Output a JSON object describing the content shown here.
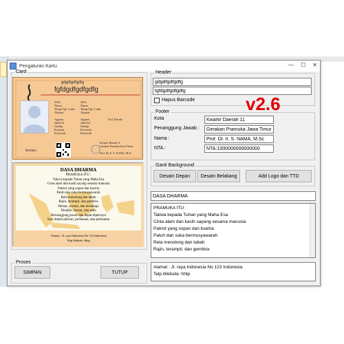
{
  "window": {
    "title": "Pengaturan Kartu",
    "minimize": "—",
    "maximize": "☐",
    "close": "✕"
  },
  "card_group": {
    "label": "Card"
  },
  "card_front": {
    "org_name": "gdgdfgdfgdfg",
    "org_name_big": "fgfdgdfgdfgdfg",
    "fields_left": [
      "NTA",
      "Nama",
      "Temp/Tgl. Lahir",
      "Alamat",
      "",
      "Agama",
      "Jab/Gol",
      "Gudep",
      "Kwaran",
      "Kwarcab"
    ],
    "fields_right": [
      "NTA",
      "Nama",
      "Temp/Tgl. Lahir",
      "Alamat",
      "",
      "Agama",
      "Jab/Gol",
      "Gudep",
      "Kwarran",
      "Kwarcab"
    ],
    "gol_darah": "Gol. Darah :",
    "berlaku": "Berlaku",
    "kwartir_sig": "Kwartir Daerah 11",
    "sig_org": "Gerakan Pramuka Jawa Timur",
    "sig_name": "Prof. Dr. Ir. S. NAMA, M.Sc"
  },
  "card_back": {
    "title": "DASA DHARMA",
    "subtitle": "PRAMUKA ITU :",
    "lines": [
      "Takwa kepada Tuhan yang Maha Esa",
      "Cinta alam dan kasih sayang sesama manusia",
      "Patriot yang sopan dan ksatria",
      "Patuh dan suka bermusyawarah",
      "Rela menolong dan tabah",
      "Rajin, terampil, dan gembira",
      "Hemat, cermat, dan bersahaja",
      "Disiplin, berani, dan setia",
      "Bertanggung jawab dan dapat dipercaya",
      "Suci dalam pikiran, perkataan, dan perbuatan"
    ],
    "alamat": "Alamat : Jl. raya Indonesia No 123 Indonesia",
    "telp": "Telp.Website :hhtp"
  },
  "header_group": {
    "label": "Header",
    "line1": "gdgdfgdfgdfg",
    "line2": "fgfdgdfgdfgdfg",
    "hapus_barcode": "Hapus Barcode",
    "hapus_checked": false
  },
  "version": "v2.6",
  "footer_group": {
    "label": "Footer",
    "kota_label": "Kota",
    "kota_value": "Kwartir Daerah 11",
    "pj_label": "Penanggung Jawab :",
    "pj_value": "Gerakan Pramuka Jawa Timur",
    "nama_label": "Nama :",
    "nama_value": "Prof. Dr. Ir. S. NAMA, M.Sc",
    "nta_label": "NTA :",
    "nta_value": "NTA:1000000000000000"
  },
  "bg_group": {
    "label": "Ganti Background",
    "btn_depan": "Desain Depan",
    "btn_belakang": "Desain Belakang",
    "btn_logo": "Add Logo dan TTD"
  },
  "dasa_title_field": "DASA DHARMA",
  "dasa_text": [
    "PRAMUKA ITU :",
    "Takwa kepada Tuhan yang Maha Esa",
    "Cinta alam dan kasih sayang sesama manusia",
    "Patriot yang sopan dan ksatria",
    "Patuh dan suka bermusyawarah",
    "Rela menolong dan tabah",
    "Rajin, terampil, dan gembira"
  ],
  "alamat_text": [
    "Alamat : Jl. raya Indonesia No 123 Indonesia",
    "Telp.Website :hhtp"
  ],
  "proses_group": {
    "label": "Proses",
    "simpan": "SIMPAN",
    "tutup": "TUTUP"
  },
  "colors": {
    "accent_red": "#e00000",
    "card_bg": "#f6c894"
  }
}
